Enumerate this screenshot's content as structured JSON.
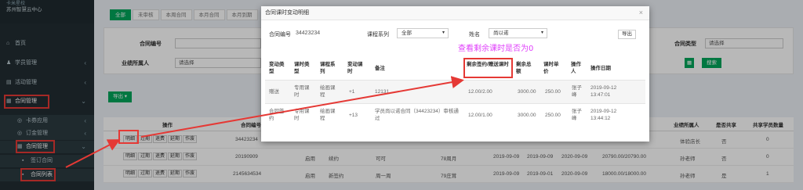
{
  "sidebar": {
    "header_line1": "卡米星校",
    "header_line2": "苏州智慧云中心",
    "items": [
      {
        "label": "首页",
        "icon": "home-icon",
        "glyph": "⌂"
      },
      {
        "label": "学员管理",
        "icon": "users-icon",
        "glyph": "♟"
      },
      {
        "label": "活动管理",
        "icon": "activity-icon",
        "glyph": "▤"
      },
      {
        "label": "合同管理",
        "icon": "contract-icon",
        "glyph": "▦"
      },
      {
        "label": "卡券应用",
        "icon": "card-icon",
        "glyph": "◎"
      },
      {
        "label": "订金管理",
        "icon": "deposit-icon",
        "glyph": "◎"
      },
      {
        "label": "合同管理",
        "icon": "contract-icon",
        "glyph": "▦"
      },
      {
        "label": "签订合同",
        "icon": "sign-icon",
        "glyph": "▪"
      },
      {
        "label": "合同列表",
        "icon": "list-icon",
        "glyph": "▪"
      }
    ],
    "arrow": "‹",
    "arrow_open": "⌄"
  },
  "main": {
    "tabs": [
      "全部",
      "未审核",
      "本周合同",
      "本月合同",
      "本月到期"
    ],
    "filters": {
      "contract_no_label": "合同编号",
      "owner_label": "业绩所属人",
      "owner_value": "请选择",
      "contract_type_label": "合同类型",
      "contract_type_value": "请选择",
      "search_label": "搜索"
    },
    "export_label": "导出 ▾",
    "table_headers": [
      "操作",
      "合同编号",
      "业绩所属人",
      "是否共享",
      "共享学员数量"
    ],
    "op_buttons": [
      "明细",
      "过期",
      "退费",
      "延期",
      "作废"
    ],
    "rows": [
      {
        "contract_no": "34423234",
        "owner": "体验店长",
        "shared": "否",
        "count": "0",
        "cols": []
      },
      {
        "contract_no": "20190909",
        "owner": "孙老师",
        "shared": "否",
        "count": "0",
        "cols": [
          "启用",
          "续约",
          "可可",
          "78周月",
          "2019-09-09",
          "2019-09-09",
          "2020-09-09",
          "20790.00/20790.00"
        ]
      },
      {
        "contract_no": "2145634534",
        "owner": "孙老师",
        "shared": "是",
        "count": "1",
        "cols": [
          "启用",
          "新签约",
          "周一周",
          "79庄茸",
          "2019-09-09",
          "2019-09-01",
          "2020-09-09",
          "18000.00/18000.00"
        ]
      }
    ]
  },
  "modal": {
    "title": "合同课时变动明细",
    "contract_no_label": "合同编号",
    "contract_no": "34423234",
    "course_series_label": "课程系列",
    "course_series_value": "全部",
    "name_label": "姓名",
    "name_value": "尚以诺",
    "export_label": "导出",
    "close": "×",
    "annotation": "查看剩余课时是否为0",
    "headers": [
      "变动类型",
      "课时类型",
      "课程系列",
      "变动课时",
      "备注",
      "剩余签约/赠送课时",
      "剩余总额",
      "课时单价",
      "操作人",
      "操作日期"
    ],
    "rows": [
      [
        "赠送",
        "专用课时",
        "绘画课程",
        "+1",
        "12131",
        "12.00/2.00",
        "3000.00",
        "250.00",
        "张子峰",
        "2019-09-12 13:47:01"
      ],
      [
        "合同签约",
        "专用课时",
        "绘画课程",
        "+13",
        "学员尚以诺合同（34423234）审核通过",
        "12.00/1.00",
        "3000.00",
        "250.00",
        "张子峰",
        "2019-09-12 13:44:12"
      ]
    ]
  },
  "colors": {
    "accent_green": "#00a65a",
    "highlight_red": "#e53935",
    "annotation_magenta": "#e040fb",
    "sidebar_bg": "#222d32"
  }
}
